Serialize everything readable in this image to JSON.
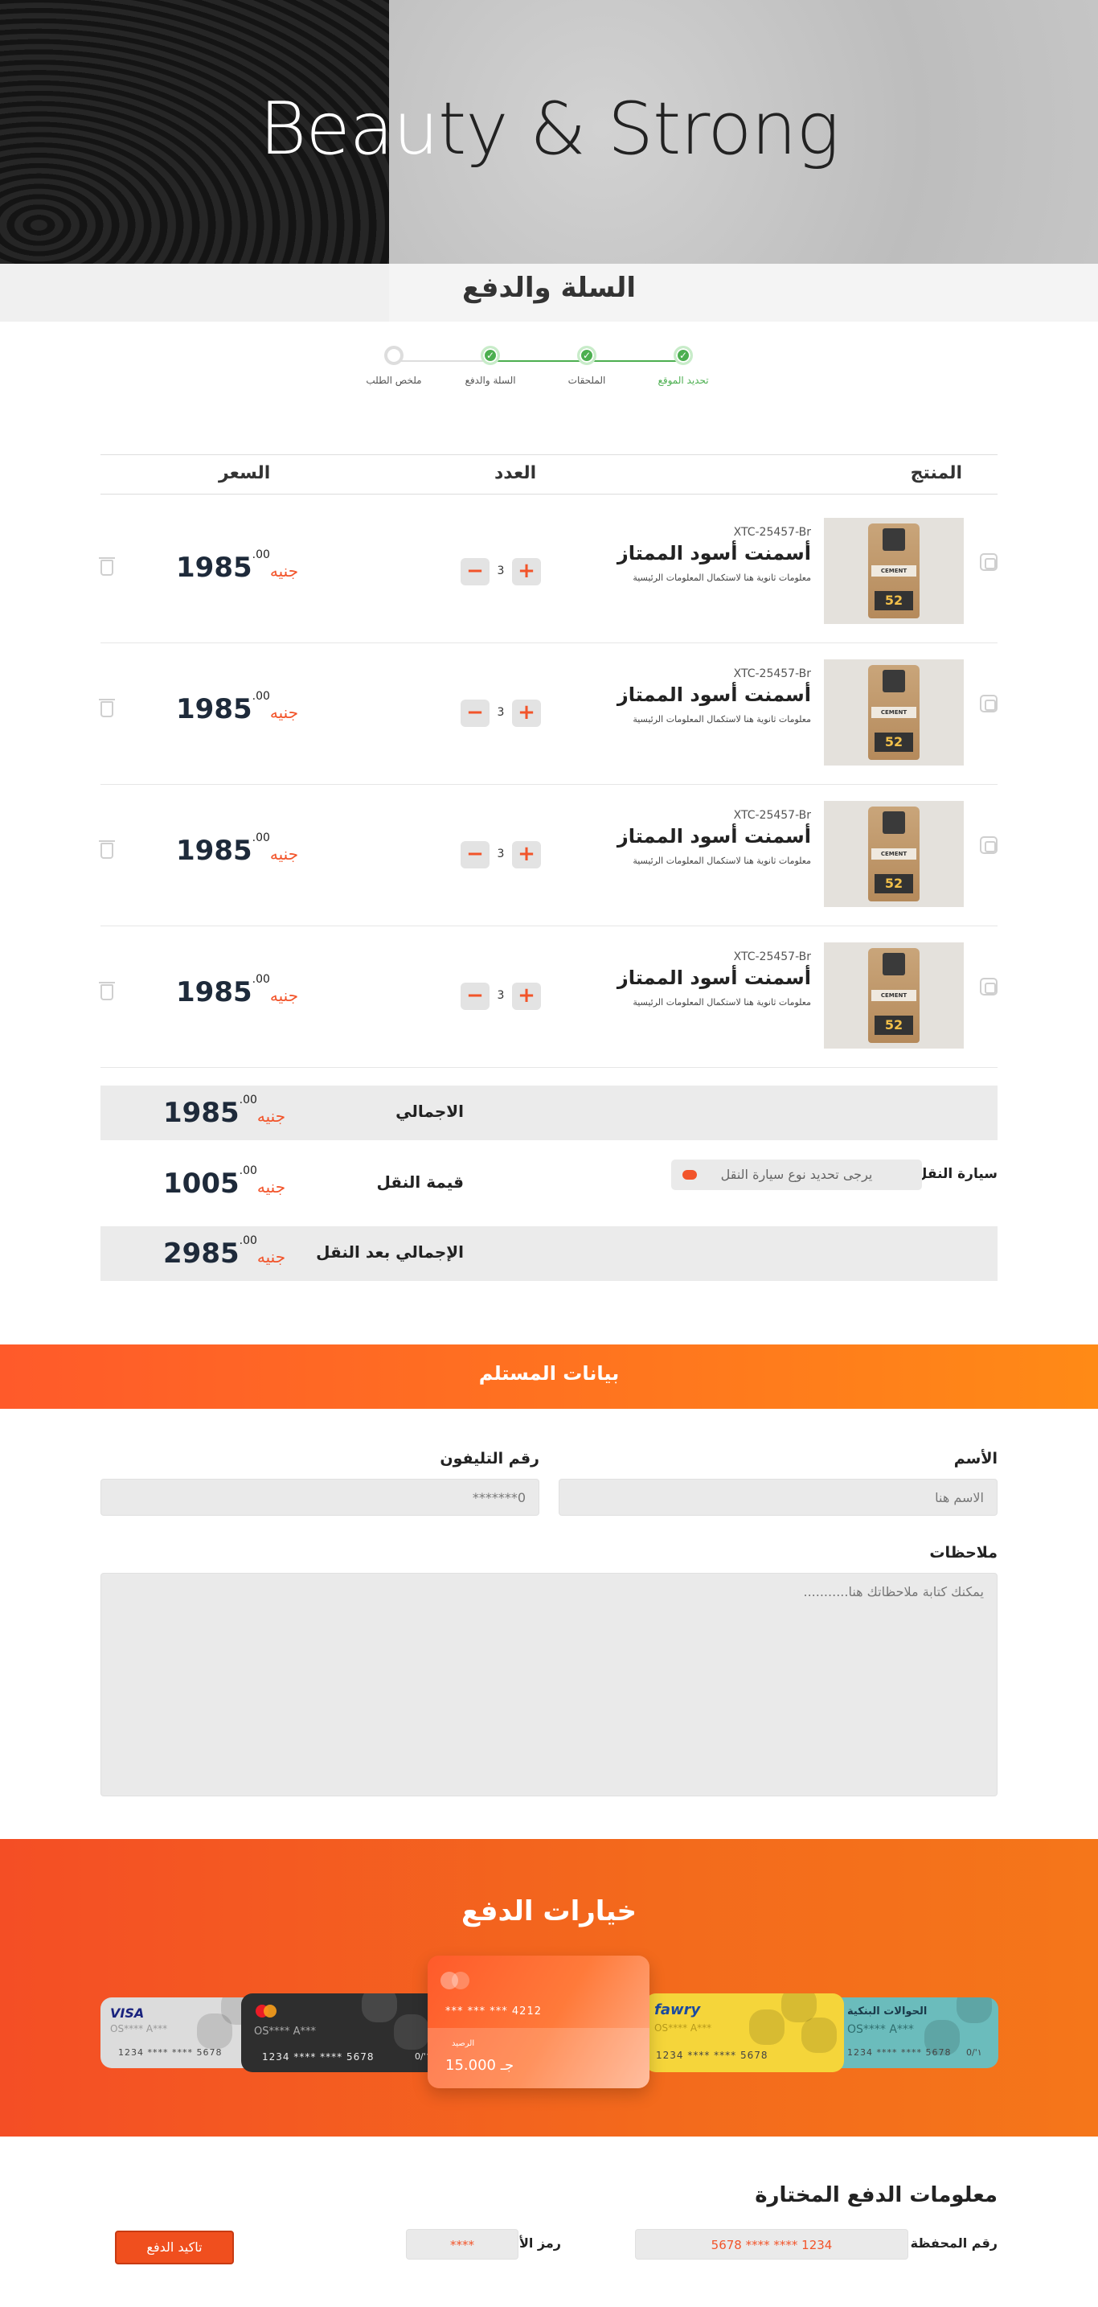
{
  "hero": {
    "title_part1": "Beau",
    "title_part2": "ty & Strong"
  },
  "page_title": "السلة والدفع",
  "steps": [
    {
      "label": "تحديد الموقع",
      "state": "done",
      "active": true
    },
    {
      "label": "الملحقات",
      "state": "done"
    },
    {
      "label": "السلة والدفع",
      "state": "done"
    },
    {
      "label": "ملخص الطلب",
      "state": "todo"
    }
  ],
  "cart": {
    "headers": {
      "product": "المنتج",
      "qty": "العدد",
      "price": "السعر"
    },
    "items": [
      {
        "sku": "XTC-25457-Br",
        "name": "أسمنت أسود الممتاز",
        "desc": "معلومات ثانوية هنا لاستكمال المعلومات الرئيسية",
        "qty": "3",
        "price": "1985",
        "decimal": ".00",
        "currency": "جنيه",
        "bag_label": "CEMENT",
        "bag_number": "52"
      },
      {
        "sku": "XTC-25457-Br",
        "name": "أسمنت أسود الممتاز",
        "desc": "معلومات ثانوية هنا لاستكمال المعلومات الرئيسية",
        "qty": "3",
        "price": "1985",
        "decimal": ".00",
        "currency": "جنيه",
        "bag_label": "CEMENT",
        "bag_number": "52"
      },
      {
        "sku": "XTC-25457-Br",
        "name": "أسمنت أسود الممتاز",
        "desc": "معلومات ثانوية هنا لاستكمال المعلومات الرئيسية",
        "qty": "3",
        "price": "1985",
        "decimal": ".00",
        "currency": "جنيه",
        "bag_label": "CEMENT",
        "bag_number": "52"
      },
      {
        "sku": "XTC-25457-Br",
        "name": "أسمنت أسود الممتاز",
        "desc": "معلومات ثانوية هنا لاستكمال المعلومات الرئيسية",
        "qty": "3",
        "price": "1985",
        "decimal": ".00",
        "currency": "جنيه",
        "bag_label": "CEMENT",
        "bag_number": "52"
      }
    ],
    "qty_plus": "+",
    "qty_minus": "−"
  },
  "summary": {
    "total": {
      "label": "الاجمالي",
      "value": "1985",
      "decimal": ".00",
      "currency": "جنيه"
    },
    "vehicle": {
      "label": "سيارة النقل",
      "placeholder": "يرجى تحديد نوع سيارة النقل"
    },
    "shipping": {
      "label": "قيمة النقل",
      "value": "1005",
      "decimal": ".00",
      "currency": "جنيه"
    },
    "grand_total": {
      "label": "الإجمالي بعد النقل",
      "value": "2985",
      "decimal": ".00",
      "currency": "جنيه"
    }
  },
  "recipient": {
    "title": "بيانات المستلم",
    "name_label": "الأسم",
    "name_placeholder": "الاسم هنا",
    "phone_label": "رقم التليفون",
    "phone_placeholder": "0*******",
    "notes_label": "ملاحظات",
    "notes_placeholder": "يمكنك كتابة ملاحظاتك هنا..........."
  },
  "payment": {
    "title": "خيارات الدفع",
    "cards": {
      "visa": {
        "brand": "VISA",
        "owner": "OS**** A***",
        "number": "1234  ****  ****  5678"
      },
      "mastercard": {
        "owner": "OS**** A***",
        "number": "1234  ****  ****  5678",
        "expiry": "0/'١"
      },
      "selected": {
        "number": "***   ***   ***   4212",
        "balance_label": "الرصيد",
        "balance": "15.000 جـ"
      },
      "fawry": {
        "brand": "fawry",
        "owner": "OS**** A***",
        "number": "1234  ****  ****  5678"
      },
      "bank": {
        "brand": "الحوالات البنكية",
        "owner": "OS**** A***",
        "number": "1234  ****  ****  5678",
        "expiry": "0/'١"
      }
    }
  },
  "payment_info": {
    "title": "معلومات الدفع المختارة",
    "wallet_label": "رقم المحفظة",
    "wallet_value": "5678 **** **** 1234",
    "cvv_label": "رمز الأمان",
    "cvv_value": "****",
    "confirm_label": "تاكيد الدفع"
  },
  "colors": {
    "accent": "#f2542a",
    "success": "#4caf50",
    "orange_end": "#ff8a16",
    "fawry_yellow": "#f5d53a",
    "bank_teal": "#5fb4b4"
  }
}
